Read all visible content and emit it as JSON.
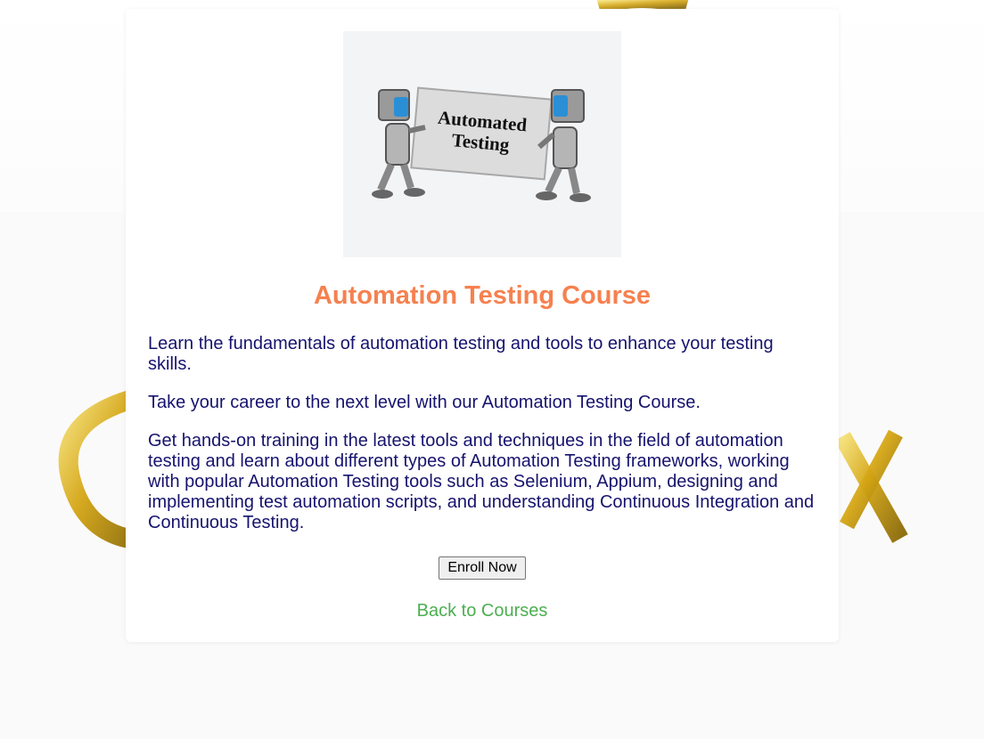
{
  "course": {
    "image_alt": "Automated Testing",
    "image_text_line1": "Automated",
    "image_text_line2": "Testing",
    "title": "Automation Testing Course",
    "paragraphs": [
      "Learn the fundamentals of automation testing and tools to enhance your testing skills.",
      "Take your career to the next level with our Automation Testing Course.",
      "Get hands-on training in the latest tools and techniques in the field of automation testing and learn about different types of Automation Testing frameworks, working with popular Automation Testing tools such as Selenium, Appium, designing and implementing test automation scripts, and understanding Continuous Integration and Continuous Testing."
    ]
  },
  "actions": {
    "enroll_label": "Enroll Now",
    "back_label": "Back to Courses"
  },
  "colors": {
    "title": "#f6814f",
    "body_text": "#16136e",
    "link": "#4caf50",
    "gold": "#d4a514"
  },
  "icons": {
    "hero": "robots-holding-sign-image",
    "background": "gold-ring-logo"
  }
}
